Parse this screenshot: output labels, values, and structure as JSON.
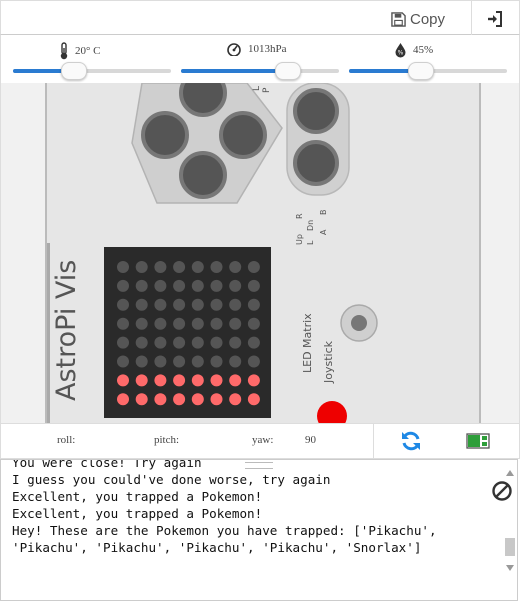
{
  "toolbar": {
    "copy_label": "Copy",
    "icons": {
      "copy": "save-icon",
      "login": "sign-in-icon"
    }
  },
  "sensors": {
    "temperature": {
      "icon": "thermometer-icon",
      "value": "20° C",
      "level": 0.38
    },
    "pressure": {
      "icon": "gauge-icon",
      "value": "1013hPa",
      "level": 0.67
    },
    "humidity": {
      "icon": "humidity-icon",
      "value": "45%",
      "level": 0.45
    }
  },
  "board": {
    "title": "AstroPi Vis",
    "led_label": "LED Matrix",
    "joystick_label": "Joystick",
    "dpad_labels": {
      "up": "Up",
      "down": "Dn",
      "left": "L",
      "right": "R"
    },
    "button_labels": {
      "a": "A",
      "b": "B"
    },
    "partial_labels": {
      "top": "L",
      "top2": "P"
    },
    "led_rows_lit": [
      7,
      8
    ],
    "colors": {
      "led_off": "#555555",
      "led_on": "#ff6a6a",
      "board": "#e6e6e6",
      "matrix_bg": "#2a2a2a",
      "red_button": "#ee0000"
    }
  },
  "imu": {
    "roll_label": "roll:",
    "roll_value": "",
    "pitch_label": "pitch:",
    "pitch_value": "",
    "yaw_label": "yaw:",
    "yaw_value": "90"
  },
  "actions": {
    "reset_icon": "refresh-icon",
    "emulator_icon": "sense-hat-icon"
  },
  "accent_color": "#2a7bd1",
  "console": {
    "lines": [
      "You were close! Try again",
      "I guess you could've done worse, try again",
      "Excellent, you trapped a Pokemon!",
      "Excellent, you trapped a Pokemon!",
      "Hey! These are the Pokemon you have trapped: ['Pikachu',",
      "'Pikachu', 'Pikachu', 'Pikachu', 'Pikachu', 'Snorlax']"
    ],
    "clear_icon": "clear-icon"
  }
}
